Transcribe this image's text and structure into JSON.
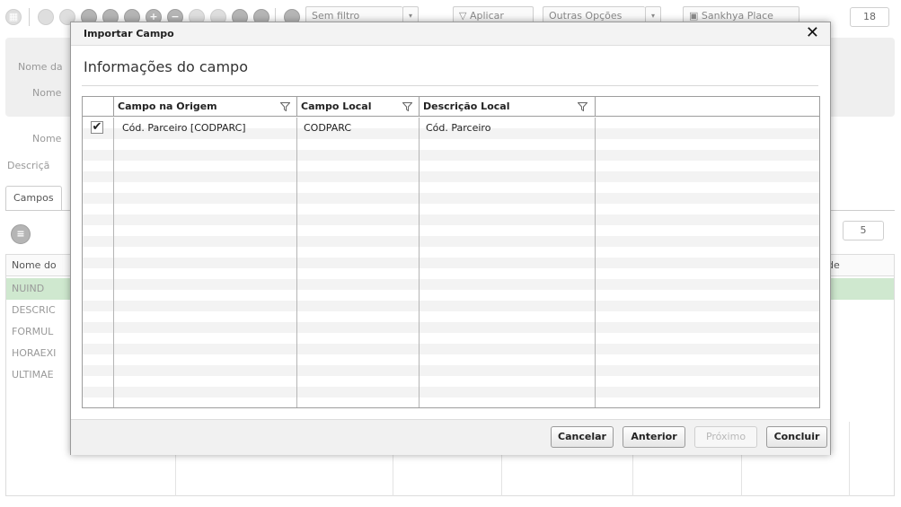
{
  "toolbar": {
    "filter_label": "Sem filtro",
    "filter_arrow": "▾",
    "apply_label": "Aplicar",
    "apply_icon": "▽",
    "other_options_label": "Outras Opções",
    "other_options_arrow": "▾",
    "place_label": "Sankhya Place",
    "counter": "18"
  },
  "background": {
    "labels": [
      "Nome da",
      "Nome",
      "Nome",
      "Descriçã"
    ],
    "tab_label": "Campos",
    "grid_counter": "5",
    "grid_header": "Nome do",
    "grid_header_right": "de",
    "rows": [
      "NUIND",
      "DESCRIC",
      "FORMUL",
      "HORAEXI",
      "ULTIMAE"
    ]
  },
  "modal": {
    "title": "Importar Campo",
    "close_label": "✕",
    "section_title": "Informações do campo",
    "columns": [
      "Campo na Origem",
      "Campo Local",
      "Descrição Local"
    ],
    "rows": [
      {
        "checked": true,
        "check_glyph": "✔",
        "origin": "Cód. Parceiro [CODPARC]",
        "local": "CODPARC",
        "description": "Cód. Parceiro"
      }
    ],
    "buttons": {
      "cancel": "Cancelar",
      "previous": "Anterior",
      "next": "Próximo",
      "finish": "Concluir"
    }
  }
}
